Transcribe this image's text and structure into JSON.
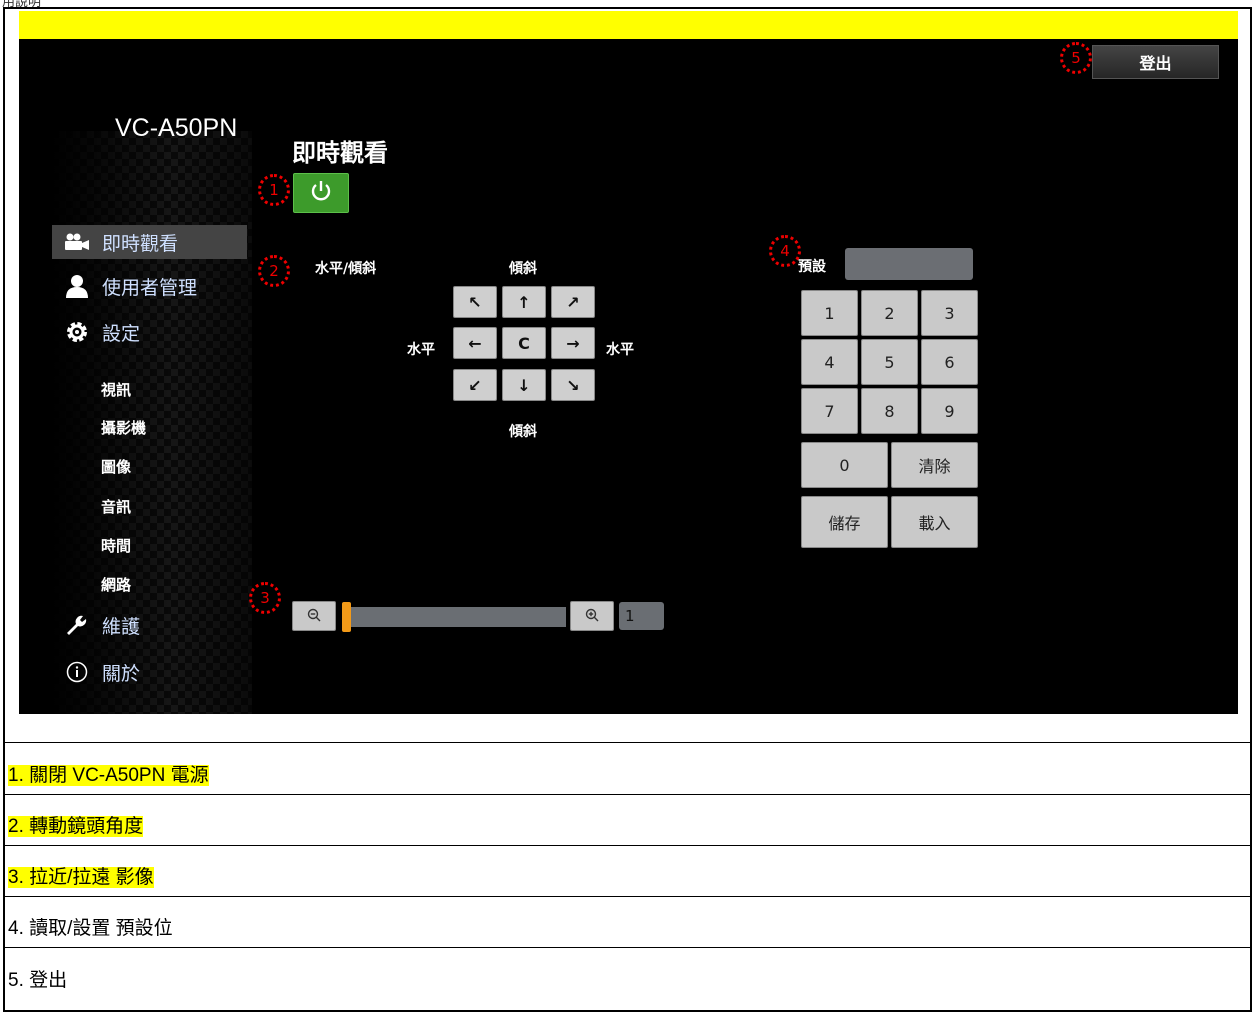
{
  "header_text": "用說明",
  "app": {
    "model": "VC-A50PN",
    "page_title": "即時觀看",
    "logout_label": "登出"
  },
  "nav": [
    {
      "label": "即時觀看",
      "icon": "video-camera-icon",
      "active": true
    },
    {
      "label": "使用者管理",
      "icon": "user-icon"
    },
    {
      "label": "設定",
      "icon": "gear-icon"
    },
    {
      "label": "維護",
      "icon": "wrench-icon"
    },
    {
      "label": "關於",
      "icon": "info-icon"
    }
  ],
  "settings_sub": [
    "視訊",
    "攝影機",
    "圖像",
    "音訊",
    "時間",
    "網路"
  ],
  "ptz": {
    "title": "水平/傾斜",
    "tilt_label_top": "傾斜",
    "tilt_label_bottom": "傾斜",
    "pan_label_left": "水平",
    "pan_label_right": "水平",
    "buttons": [
      "↖",
      "↑",
      "↗",
      "←",
      "C",
      "→",
      "↙",
      "↓",
      "↘"
    ]
  },
  "preset": {
    "label": "預設",
    "value": "",
    "keys": [
      "1",
      "2",
      "3",
      "4",
      "5",
      "6",
      "7",
      "8",
      "9",
      "0"
    ],
    "clear_label": "清除",
    "save_label": "儲存",
    "load_label": "載入"
  },
  "zoom": {
    "value": "1",
    "level": 0.0
  },
  "markers": [
    "1",
    "2",
    "3",
    "4",
    "5"
  ],
  "notes": [
    {
      "text": "1.  關閉 VC-A50PN 電源",
      "highlight": true
    },
    {
      "text": "2.  轉動鏡頭角度",
      "highlight": true
    },
    {
      "text": "3.  拉近/拉遠  影像",
      "highlight": true
    },
    {
      "text": "4.  讀取/設置  預設位",
      "highlight": false
    },
    {
      "text": "5.  登出",
      "highlight": false
    }
  ],
  "colors": {
    "accent_green": "#3d9b2b",
    "highlight_yellow": "#ffff00",
    "marker_red": "#e00000",
    "zoom_thumb": "#f39a18"
  }
}
